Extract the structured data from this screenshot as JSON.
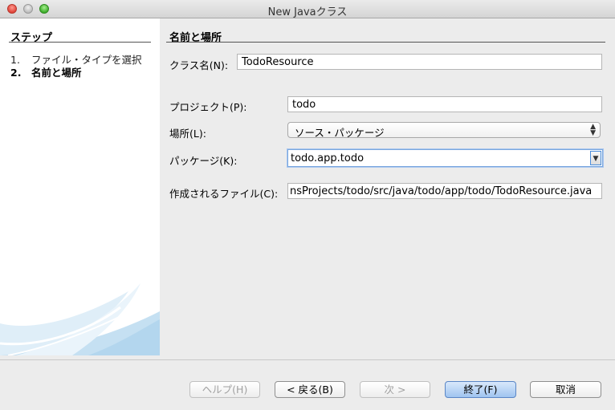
{
  "window": {
    "title": "New Javaクラス"
  },
  "sidebar": {
    "heading": "ステップ",
    "steps": [
      {
        "num": "1.",
        "label": "ファイル・タイプを選択"
      },
      {
        "num": "2.",
        "label": "名前と場所"
      }
    ]
  },
  "main": {
    "heading": "名前と場所",
    "class_name": {
      "label": "クラス名(N):",
      "value": "TodoResource"
    },
    "project": {
      "label": "プロジェクト(P):",
      "value": "todo"
    },
    "location": {
      "label": "場所(L):",
      "value": "ソース・パッケージ"
    },
    "package": {
      "label": "パッケージ(K):",
      "value": "todo.app.todo"
    },
    "created_file": {
      "label": "作成されるファイル(C):",
      "value": "nsProjects/todo/src/java/todo/app/todo/TodoResource.java"
    }
  },
  "buttons": {
    "help": "ヘルプ(H)",
    "back": "< 戻る(B)",
    "next": "次 >",
    "finish": "終了(F)",
    "cancel": "取消"
  },
  "colors": {
    "accent": "#5a86c6",
    "sidebar_bg": "#ffffff",
    "window_bg": "#ececec"
  }
}
